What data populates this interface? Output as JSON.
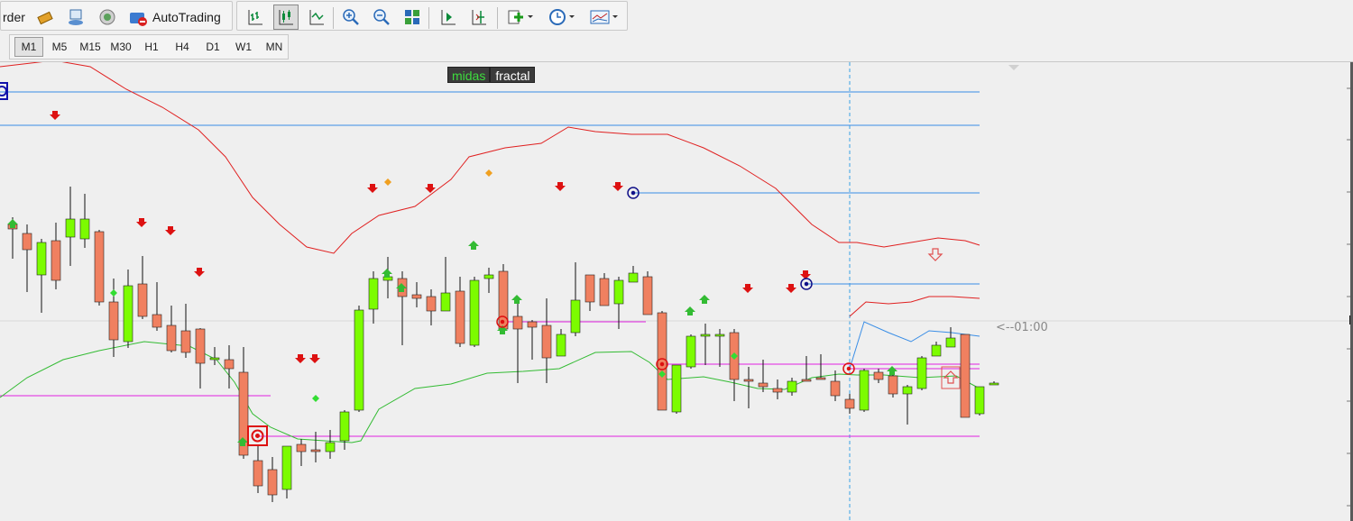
{
  "toolbar": {
    "order_label": "rder",
    "autotrading_label": "AutoTrading",
    "icons": [
      "order-icon",
      "history-icon",
      "market-watch-icon",
      "signals-icon",
      "autotrading-icon",
      "bar-chart-icon",
      "candlestick-icon",
      "line-chart-icon",
      "zoom-in-icon",
      "zoom-out-icon",
      "tile-windows-icon",
      "auto-scroll-icon",
      "chart-shift-icon",
      "indicators-icon",
      "periods-icon",
      "templates-icon"
    ]
  },
  "timeframes": [
    "M1",
    "M5",
    "M15",
    "M30",
    "H1",
    "H4",
    "D1",
    "W1",
    "MN"
  ],
  "active_timeframe": "M1",
  "chart": {
    "tag_left": "midas",
    "tag_right": "fractal",
    "countdown": "<--01:00",
    "colors": {
      "bull": "#7cfc00",
      "bear": "#f08060",
      "upper_band": "#e02020",
      "lower_band": "#33bb33",
      "hline_blue": "#3a8ee6",
      "hline_magenta": "#e020e0",
      "up_arrow": "#33bb33",
      "down_arrow": "#dd1111"
    }
  },
  "chart_data": {
    "type": "candlestick",
    "price_scale": "unlabeled",
    "candles": [
      {
        "o": 180,
        "h": 172,
        "l": 218,
        "c": 185,
        "dir": "bear"
      },
      {
        "o": 190,
        "h": 180,
        "l": 255,
        "c": 208,
        "dir": "bear"
      },
      {
        "o": 236,
        "h": 196,
        "l": 278,
        "c": 200,
        "dir": "bull"
      },
      {
        "o": 198,
        "h": 178,
        "l": 252,
        "c": 242,
        "dir": "bear"
      },
      {
        "o": 194,
        "h": 138,
        "l": 226,
        "c": 174,
        "dir": "bull"
      },
      {
        "o": 174,
        "h": 146,
        "l": 206,
        "c": 196,
        "dir": "bull"
      },
      {
        "o": 188,
        "h": 186,
        "l": 270,
        "c": 266,
        "dir": "bear"
      },
      {
        "o": 266,
        "h": 240,
        "l": 327,
        "c": 308,
        "dir": "bear"
      },
      {
        "o": 310,
        "h": 230,
        "l": 317,
        "c": 248,
        "dir": "bull"
      },
      {
        "o": 246,
        "h": 215,
        "l": 285,
        "c": 282,
        "dir": "bear"
      },
      {
        "o": 280,
        "h": 244,
        "l": 298,
        "c": 294,
        "dir": "bear"
      },
      {
        "o": 292,
        "h": 270,
        "l": 322,
        "c": 320,
        "dir": "bear"
      },
      {
        "o": 298,
        "h": 268,
        "l": 328,
        "c": 322,
        "dir": "bear"
      },
      {
        "o": 296,
        "h": 295,
        "l": 362,
        "c": 334,
        "dir": "bear"
      },
      {
        "o": 328,
        "h": 316,
        "l": 336,
        "c": 330,
        "dir": "bull"
      },
      {
        "o": 330,
        "h": 314,
        "l": 362,
        "c": 340,
        "dir": "bear"
      },
      {
        "o": 344,
        "h": 316,
        "l": 440,
        "c": 436,
        "dir": "bear"
      },
      {
        "o": 470,
        "h": 426,
        "l": 478,
        "c": 442,
        "dir": "bear"
      },
      {
        "o": 452,
        "h": 438,
        "l": 488,
        "c": 480,
        "dir": "bear"
      },
      {
        "o": 474,
        "h": 426,
        "l": 484,
        "c": 426,
        "dir": "bull"
      },
      {
        "o": 424,
        "h": 418,
        "l": 448,
        "c": 432,
        "dir": "bear"
      },
      {
        "o": 430,
        "h": 410,
        "l": 444,
        "c": 432,
        "dir": "bear"
      },
      {
        "o": 432,
        "h": 408,
        "l": 440,
        "c": 422,
        "dir": "bull"
      },
      {
        "o": 420,
        "h": 386,
        "l": 430,
        "c": 388,
        "dir": "bull"
      },
      {
        "o": 386,
        "h": 270,
        "l": 388,
        "c": 275,
        "dir": "bull"
      },
      {
        "o": 274,
        "h": 232,
        "l": 290,
        "c": 240,
        "dir": "bull"
      },
      {
        "o": 238,
        "h": 216,
        "l": 262,
        "c": 242,
        "dir": "bull"
      },
      {
        "o": 240,
        "h": 232,
        "l": 314,
        "c": 260,
        "dir": "bear"
      },
      {
        "o": 258,
        "h": 244,
        "l": 272,
        "c": 262,
        "dir": "bear"
      },
      {
        "o": 260,
        "h": 252,
        "l": 292,
        "c": 276,
        "dir": "bear"
      },
      {
        "o": 276,
        "h": 216,
        "l": 276,
        "c": 256,
        "dir": "bull"
      },
      {
        "o": 254,
        "h": 238,
        "l": 316,
        "c": 312,
        "dir": "bear"
      },
      {
        "o": 314,
        "h": 238,
        "l": 316,
        "c": 242,
        "dir": "bull"
      },
      {
        "o": 240,
        "h": 228,
        "l": 256,
        "c": 236,
        "dir": "bull"
      },
      {
        "o": 232,
        "h": 224,
        "l": 298,
        "c": 296,
        "dir": "bear"
      },
      {
        "o": 282,
        "h": 262,
        "l": 356,
        "c": 296,
        "dir": "bear"
      },
      {
        "o": 288,
        "h": 286,
        "l": 330,
        "c": 294,
        "dir": "bear"
      },
      {
        "o": 292,
        "h": 262,
        "l": 356,
        "c": 328,
        "dir": "bear"
      },
      {
        "o": 326,
        "h": 296,
        "l": 326,
        "c": 302,
        "dir": "bull"
      },
      {
        "o": 300,
        "h": 222,
        "l": 304,
        "c": 264,
        "dir": "bull"
      },
      {
        "o": 236,
        "h": 240,
        "l": 276,
        "c": 266,
        "dir": "bear"
      },
      {
        "o": 240,
        "h": 234,
        "l": 270,
        "c": 270,
        "dir": "bear"
      },
      {
        "o": 268,
        "h": 238,
        "l": 296,
        "c": 242,
        "dir": "bull"
      },
      {
        "o": 244,
        "h": 226,
        "l": 244,
        "c": 234,
        "dir": "bull"
      },
      {
        "o": 238,
        "h": 232,
        "l": 280,
        "c": 280,
        "dir": "bear"
      },
      {
        "o": 278,
        "h": 276,
        "l": 386,
        "c": 386,
        "dir": "bear"
      },
      {
        "o": 388,
        "h": 336,
        "l": 390,
        "c": 336,
        "dir": "bull"
      },
      {
        "o": 338,
        "h": 302,
        "l": 340,
        "c": 304,
        "dir": "bull"
      },
      {
        "o": 302,
        "h": 290,
        "l": 336,
        "c": 304,
        "dir": "bull"
      },
      {
        "o": 302,
        "h": 296,
        "l": 338,
        "c": 302,
        "dir": "bull"
      },
      {
        "o": 300,
        "h": 296,
        "l": 376,
        "c": 352,
        "dir": "bear"
      },
      {
        "o": 352,
        "h": 338,
        "l": 384,
        "c": 354,
        "dir": "bear"
      },
      {
        "o": 356,
        "h": 330,
        "l": 366,
        "c": 360,
        "dir": "bear"
      },
      {
        "o": 362,
        "h": 352,
        "l": 374,
        "c": 366,
        "dir": "bear"
      },
      {
        "o": 366,
        "h": 350,
        "l": 370,
        "c": 354,
        "dir": "bull"
      },
      {
        "o": 352,
        "h": 326,
        "l": 354,
        "c": 352,
        "dir": "bear"
      },
      {
        "o": 350,
        "h": 324,
        "l": 352,
        "c": 352,
        "dir": "bear"
      },
      {
        "o": 354,
        "h": 342,
        "l": 376,
        "c": 370,
        "dir": "bear"
      },
      {
        "o": 374,
        "h": 368,
        "l": 390,
        "c": 384,
        "dir": "bear"
      },
      {
        "o": 386,
        "h": 340,
        "l": 388,
        "c": 342,
        "dir": "bull"
      },
      {
        "o": 344,
        "h": 340,
        "l": 356,
        "c": 352,
        "dir": "bear"
      },
      {
        "o": 348,
        "h": 340,
        "l": 372,
        "c": 368,
        "dir": "bear"
      },
      {
        "o": 368,
        "h": 358,
        "l": 402,
        "c": 360,
        "dir": "bull"
      },
      {
        "o": 362,
        "h": 326,
        "l": 364,
        "c": 328,
        "dir": "bull"
      },
      {
        "o": 326,
        "h": 310,
        "l": 326,
        "c": 314,
        "dir": "bull"
      },
      {
        "o": 316,
        "h": 294,
        "l": 316,
        "c": 306,
        "dir": "bull"
      },
      {
        "o": 302,
        "h": 302,
        "l": 394,
        "c": 394,
        "dir": "bear"
      },
      {
        "o": 390,
        "h": 360,
        "l": 392,
        "c": 360,
        "dir": "bull"
      },
      {
        "o": 356,
        "h": 354,
        "l": 358,
        "c": 356,
        "dir": "bull"
      }
    ]
  }
}
